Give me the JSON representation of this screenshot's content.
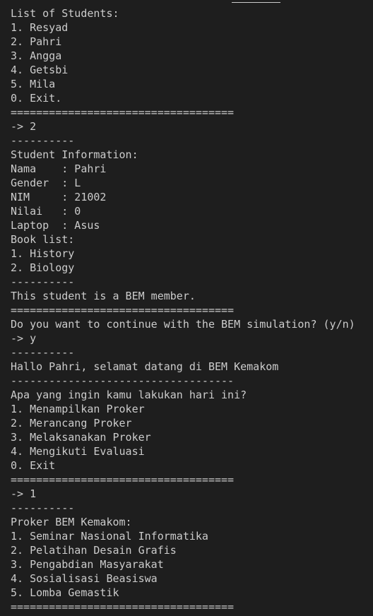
{
  "terminal": {
    "lines": [
      "List of Students:",
      "1. Resyad",
      "2. Pahri",
      "3. Angga",
      "4. Getsbi",
      "5. Mila",
      "0. Exit.",
      "===================================",
      "-> 2",
      "----------",
      "Student Information:",
      "Nama    : Pahri",
      "Gender  : L",
      "NIM     : 21002",
      "Nilai   : 0",
      "Laptop  : Asus",
      "Book list:",
      "1. History",
      "2. Biology",
      "----------",
      "This student is a BEM member.",
      "===================================",
      "Do you want to continue with the BEM simulation? (y/n)",
      "-> y",
      "----------",
      "Hallo Pahri, selamat datang di BEM Kemakom",
      "-----------------------------------",
      "Apa yang ingin kamu lakukan hari ini?",
      "1. Menampilkan Proker",
      "2. Merancang Proker",
      "3. Melaksanakan Proker",
      "4. Mengikuti Evaluasi",
      "0. Exit",
      "===================================",
      "-> 1",
      "----------",
      "Proker BEM Kemakom:",
      "1. Seminar Nasional Informatika",
      "2. Pelatihan Desain Grafis",
      "3. Pengabdian Masyarakat",
      "4. Sosialisasi Beasiswa",
      "5. Lomba Gemastik",
      "==================================="
    ]
  }
}
